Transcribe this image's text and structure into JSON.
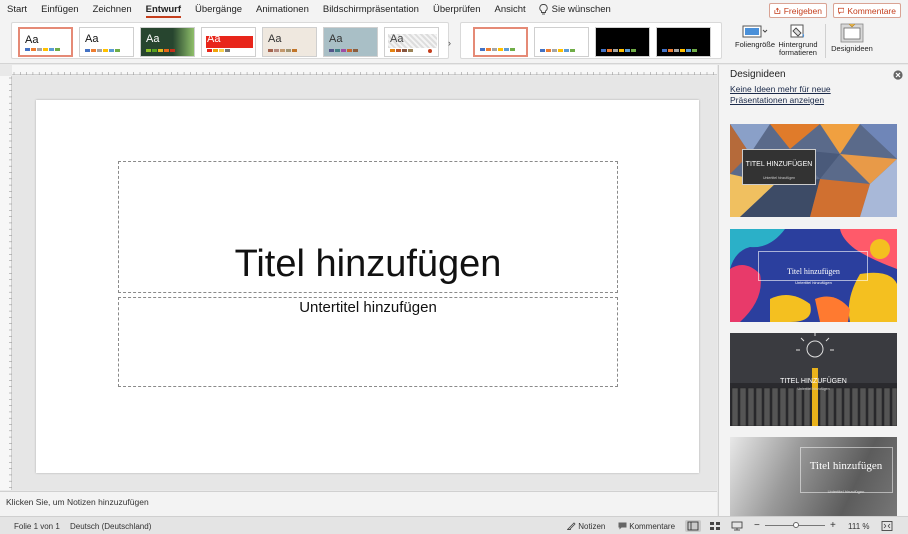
{
  "menu": {
    "tabs": [
      "Start",
      "Einfügen",
      "Zeichnen",
      "Entwurf",
      "Übergänge",
      "Animationen",
      "Bildschirmpräsentation",
      "Überprüfen",
      "Ansicht"
    ],
    "active_tab": "Entwurf",
    "tell_me": "Sie wünschen",
    "share_label": "Freigeben",
    "comments_label": "Kommentare"
  },
  "ribbon": {
    "theme_aa": "Aa",
    "slide_size_label": "Foliengröße",
    "format_background_label": "Hintergrund formatieren",
    "design_ideas_label": "Designideen"
  },
  "slide": {
    "title_placeholder": "Titel hinzufügen",
    "subtitle_placeholder": "Untertitel hinzufügen"
  },
  "notes": {
    "placeholder": "Klicken Sie, um Notizen hinzuzufügen"
  },
  "design_pane": {
    "title": "Designideen",
    "link": "Keine Ideen mehr für neue Präsentationen anzeigen",
    "ideas": [
      {
        "title": "TITEL HINZUFÜGEN",
        "subtitle": "Untertitel hinzufügen"
      },
      {
        "title": "Titel hinzufügen",
        "subtitle": "Untertitel hinzufügen"
      },
      {
        "title": "TITEL HINZUFÜGEN",
        "subtitle": "Untertitel hinzufügen"
      },
      {
        "title": "Titel hinzufügen",
        "subtitle": "Untertitel hinzufügen"
      }
    ]
  },
  "status": {
    "slide_counter": "Folie 1 von 1",
    "language": "Deutsch (Deutschland)",
    "notes_label": "Notizen",
    "comments_label": "Kommentare",
    "zoom_minus": "−",
    "zoom_plus": "+",
    "zoom_level": "111 %"
  },
  "colors": {
    "accent": "#c43e1c",
    "selection_border": "#e58a76"
  }
}
